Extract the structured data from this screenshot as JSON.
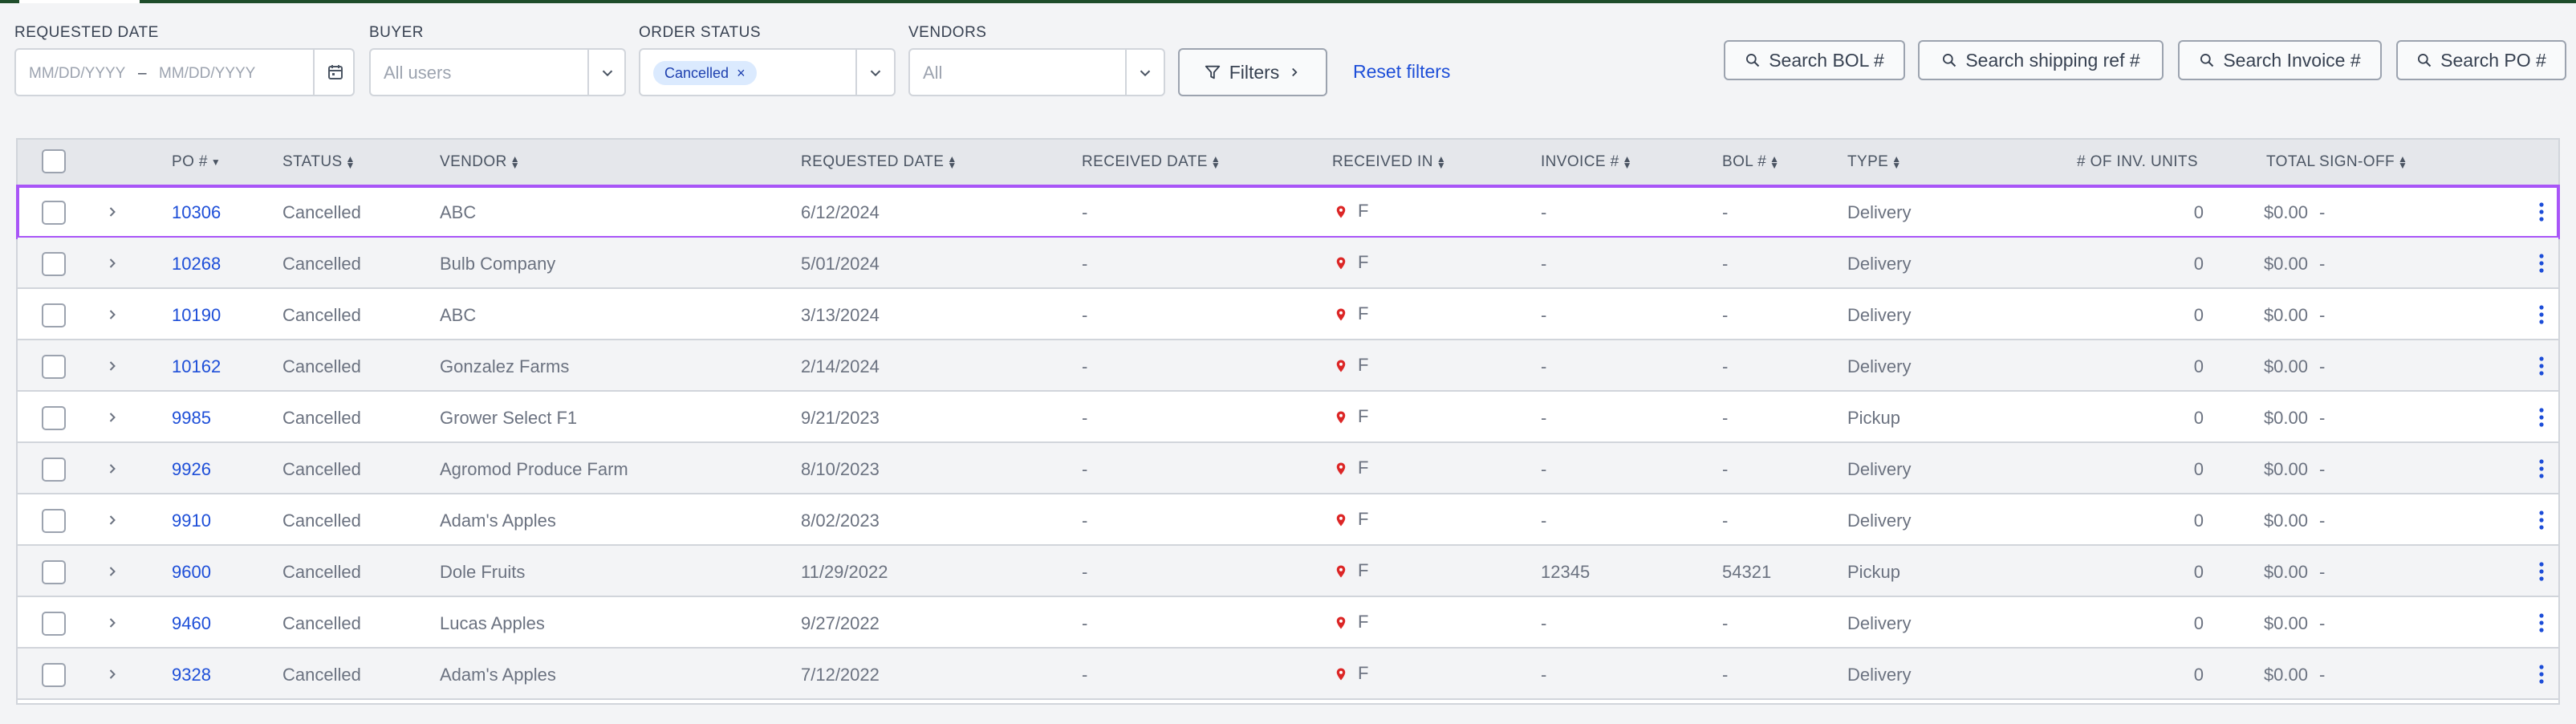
{
  "filters": {
    "requested_date": {
      "label": "REQUESTED DATE",
      "from_placeholder": "MM/DD/YYYY",
      "separator": "–",
      "to_placeholder": "MM/DD/YYYY"
    },
    "buyer": {
      "label": "BUYER",
      "value": "All users"
    },
    "order_status": {
      "label": "ORDER STATUS",
      "chip": "Cancelled",
      "chip_remove": "×"
    },
    "vendors": {
      "label": "VENDORS",
      "value": "All"
    },
    "filters_button": "Filters",
    "reset_link": "Reset filters",
    "search_buttons": [
      "Search BOL #",
      "Search shipping ref #",
      "Search Invoice #",
      "Search PO #"
    ]
  },
  "table": {
    "columns": [
      "PO #",
      "STATUS",
      "VENDOR",
      "REQUESTED DATE",
      "RECEIVED DATE",
      "RECEIVED IN",
      "INVOICE #",
      "BOL #",
      "TYPE",
      "# OF INV. UNITS",
      "TOTAL",
      "SIGN-OFF"
    ],
    "rows": [
      {
        "po": "10306",
        "status": "Cancelled",
        "vendor": "ABC",
        "requested": "6/12/2024",
        "received": "-",
        "received_in": "F",
        "invoice": "-",
        "bol": "-",
        "type": "Delivery",
        "units": "0",
        "total": "$0.00",
        "signoff": "-"
      },
      {
        "po": "10268",
        "status": "Cancelled",
        "vendor": "Bulb Company",
        "requested": "5/01/2024",
        "received": "-",
        "received_in": "F",
        "invoice": "-",
        "bol": "-",
        "type": "Delivery",
        "units": "0",
        "total": "$0.00",
        "signoff": "-"
      },
      {
        "po": "10190",
        "status": "Cancelled",
        "vendor": "ABC",
        "requested": "3/13/2024",
        "received": "-",
        "received_in": "F",
        "invoice": "-",
        "bol": "-",
        "type": "Delivery",
        "units": "0",
        "total": "$0.00",
        "signoff": "-"
      },
      {
        "po": "10162",
        "status": "Cancelled",
        "vendor": "Gonzalez Farms",
        "requested": "2/14/2024",
        "received": "-",
        "received_in": "F",
        "invoice": "-",
        "bol": "-",
        "type": "Delivery",
        "units": "0",
        "total": "$0.00",
        "signoff": "-"
      },
      {
        "po": "9985",
        "status": "Cancelled",
        "vendor": "Grower Select F1",
        "requested": "9/21/2023",
        "received": "-",
        "received_in": "F",
        "invoice": "-",
        "bol": "-",
        "type": "Pickup",
        "units": "0",
        "total": "$0.00",
        "signoff": "-"
      },
      {
        "po": "9926",
        "status": "Cancelled",
        "vendor": "Agromod Produce Farm",
        "requested": "8/10/2023",
        "received": "-",
        "received_in": "F",
        "invoice": "-",
        "bol": "-",
        "type": "Delivery",
        "units": "0",
        "total": "$0.00",
        "signoff": "-"
      },
      {
        "po": "9910",
        "status": "Cancelled",
        "vendor": "Adam's Apples",
        "requested": "8/02/2023",
        "received": "-",
        "received_in": "F",
        "invoice": "-",
        "bol": "-",
        "type": "Delivery",
        "units": "0",
        "total": "$0.00",
        "signoff": "-"
      },
      {
        "po": "9600",
        "status": "Cancelled",
        "vendor": "Dole Fruits",
        "requested": "11/29/2022",
        "received": "-",
        "received_in": "F",
        "invoice": "12345",
        "bol": "54321",
        "type": "Pickup",
        "units": "0",
        "total": "$0.00",
        "signoff": "-"
      },
      {
        "po": "9460",
        "status": "Cancelled",
        "vendor": "Lucas Apples",
        "requested": "9/27/2022",
        "received": "-",
        "received_in": "F",
        "invoice": "-",
        "bol": "-",
        "type": "Delivery",
        "units": "0",
        "total": "$0.00",
        "signoff": "-"
      },
      {
        "po": "9328",
        "status": "Cancelled",
        "vendor": "Adam's Apples",
        "requested": "7/12/2022",
        "received": "-",
        "received_in": "F",
        "invoice": "-",
        "bol": "-",
        "type": "Delivery",
        "units": "0",
        "total": "$0.00",
        "signoff": "-"
      }
    ]
  },
  "colors": {
    "accent": "#1d4ed8",
    "highlight": "#a855f7",
    "pin": "#dc2626",
    "brand_bar": "#1f4d2b"
  },
  "icons": [
    "calendar-icon",
    "chevron-down-icon",
    "filter-icon",
    "chevron-right-icon",
    "search-icon",
    "location-pin-icon",
    "kebab-menu-icon"
  ]
}
